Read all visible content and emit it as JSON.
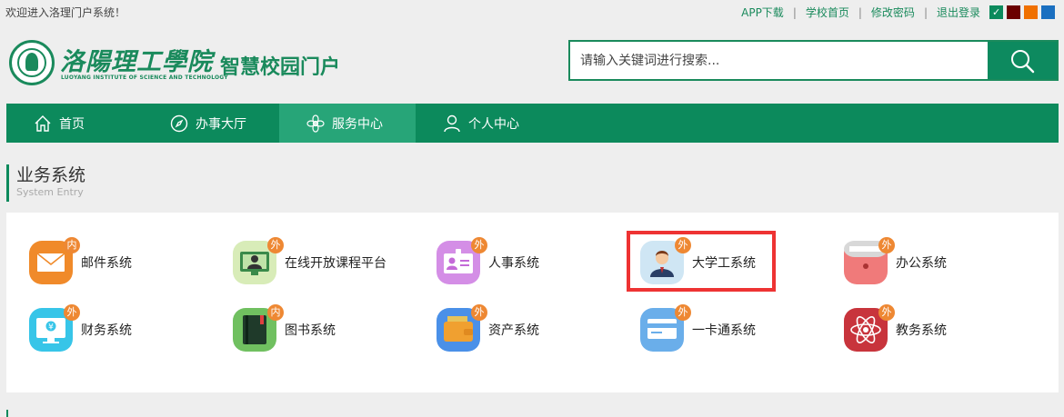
{
  "topbar": {
    "welcome": "欢迎进入洛理门户系统！",
    "links": [
      "APP下载",
      "学校首页",
      "修改密码",
      "退出登录"
    ],
    "themes": [
      {
        "color": "#0c8a5c",
        "selected": true
      },
      {
        "color": "#6b0000",
        "selected": false
      },
      {
        "color": "#f07000",
        "selected": false
      },
      {
        "color": "#1a6fc0",
        "selected": false
      }
    ]
  },
  "header": {
    "school_name": "洛陽理工學院",
    "school_en": "LUOYANG INSTITUTE OF SCIENCE AND TECHNOLOGY",
    "portal_title": "智慧校园门户",
    "search_placeholder": "请输入关键词进行搜索...",
    "search_icon": "search-icon"
  },
  "nav": {
    "items": [
      {
        "label": "首页",
        "icon": "home-icon",
        "active": false
      },
      {
        "label": "办事大厅",
        "icon": "compass-icon",
        "active": false
      },
      {
        "label": "服务中心",
        "icon": "flower-icon",
        "active": true
      },
      {
        "label": "个人中心",
        "icon": "user-icon",
        "active": false
      }
    ]
  },
  "section": {
    "title": "业务系统",
    "subtitle": "System Entry"
  },
  "apps": [
    {
      "label": "邮件系统",
      "badge": "内",
      "icon": "mail-icon",
      "color": "#f08a2a"
    },
    {
      "label": "在线开放课程平台",
      "badge": "外",
      "icon": "course-icon",
      "color": "#d8ecb8"
    },
    {
      "label": "人事系统",
      "badge": "外",
      "icon": "id-card-icon",
      "color": "#d48ee6"
    },
    {
      "label": "大学工系统",
      "badge": "外",
      "icon": "student-icon",
      "color": "#cfe6f4"
    },
    {
      "label": "办公系统",
      "badge": "外",
      "icon": "printer-icon",
      "color": "#f07a7a"
    },
    {
      "label": "财务系统",
      "badge": "外",
      "icon": "finance-icon",
      "color": "#37c5e8"
    },
    {
      "label": "图书系统",
      "badge": "内",
      "icon": "book-icon",
      "color": "#70c060"
    },
    {
      "label": "资产系统",
      "badge": "外",
      "icon": "wallet-icon",
      "color": "#4a90e8"
    },
    {
      "label": "一卡通系统",
      "badge": "外",
      "icon": "card-icon",
      "color": "#6aaeea"
    },
    {
      "label": "教务系统",
      "badge": "外",
      "icon": "atom-icon",
      "color": "#c8343c"
    }
  ]
}
